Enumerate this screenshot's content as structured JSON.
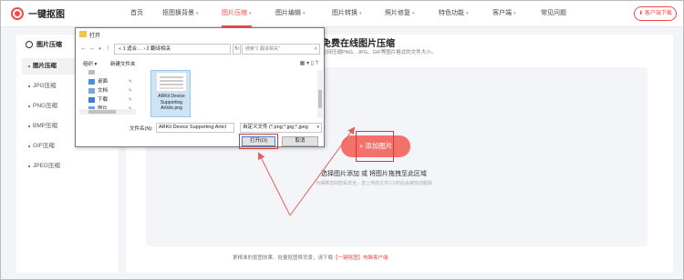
{
  "header": {
    "logo": "一键抠图",
    "nav": [
      {
        "label": "首页",
        "caret": false,
        "active": false
      },
      {
        "label": "抠图换背景",
        "caret": true,
        "active": false
      },
      {
        "label": "图片压缩",
        "caret": true,
        "active": true
      },
      {
        "label": "图片编辑",
        "caret": true,
        "active": false
      },
      {
        "label": "图片转换",
        "caret": true,
        "active": false
      },
      {
        "label": "照片修复",
        "caret": true,
        "active": false
      },
      {
        "label": "特色功能",
        "caret": true,
        "active": false
      },
      {
        "label": "客户端",
        "caret": true,
        "active": false
      },
      {
        "label": "常见问题",
        "caret": false,
        "active": false
      }
    ],
    "client_download": "⬇ 客户端下载"
  },
  "sidebar": {
    "title": "图片压缩",
    "items": [
      {
        "label": "图片压缩",
        "active": true
      },
      {
        "label": "JPG压缩",
        "active": false
      },
      {
        "label": "PNG压缩",
        "active": false
      },
      {
        "label": "BMP压缩",
        "active": false
      },
      {
        "label": "GIF压缩",
        "active": false
      },
      {
        "label": "JPEG压缩",
        "active": false
      }
    ]
  },
  "main": {
    "title": "免费在线图片压缩",
    "subtitle": "支持压缩PNG、JPG、GIF等图片格式的文件大小。",
    "add_button": "+ 添加图片",
    "drop_tip": "选择图片添加 或 将图片拖拽至此区域",
    "drop_note": "为保障您的隐私安全，您上传的文件1小时后会被自动删除",
    "footer_prefix": "更精准的抠图效果、批量抠图换背景，请下载",
    "footer_link": "【一键抠图】电脑客户端"
  },
  "dialog": {
    "title": "打开",
    "address": "« 1 适合… › 2 翻译相关",
    "search_placeholder": "搜索\"2 翻译相关\"",
    "organize": "组织 ▾",
    "new_folder": "新建文件夹",
    "tree": [
      {
        "label": "桌面"
      },
      {
        "label": "文档"
      },
      {
        "label": "下载"
      },
      {
        "label": "图片"
      }
    ],
    "file_name_display": "ARKit Device Supporting Article.png",
    "filename_label": "文件名(N):",
    "filename_value": "ARKit Device Supporting Articl",
    "filetype_value": "自定义文件 (*.png;*.jpg;*.jpeg",
    "open_button": "打开(O)",
    "cancel_button": "取消"
  },
  "colors": {
    "accent": "#f04a4a",
    "add_button": "#f2716b"
  }
}
